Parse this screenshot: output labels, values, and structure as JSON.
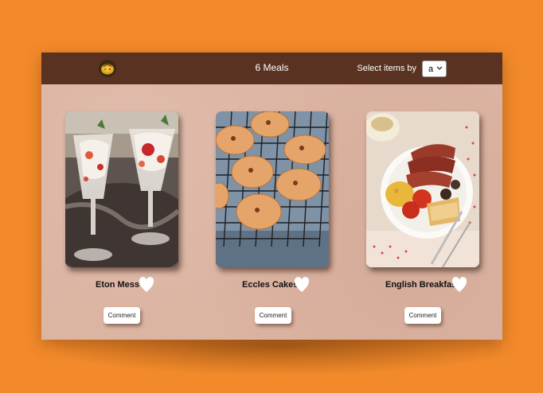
{
  "header": {
    "title": "6 Meals",
    "select_label": "Select items by",
    "select_value": "a"
  },
  "meals": [
    {
      "name": "Eton Mess",
      "comment_label": "Comment",
      "photo": "eton-mess-dessert-glasses"
    },
    {
      "name": "Eccles Cakes",
      "comment_label": "Comment",
      "photo": "eccles-cakes-on-cooling-rack"
    },
    {
      "name": "English Breakfast",
      "comment_label": "Comment",
      "photo": "english-breakfast-plate"
    }
  ],
  "icons": {
    "logo": "bread-logo-icon",
    "favorite": "heart-icon",
    "dropdown": "chevron-down-icon"
  },
  "colors": {
    "page_background": "#f28a2b",
    "header": "#5a3222",
    "panel": "#dcb4a2"
  }
}
